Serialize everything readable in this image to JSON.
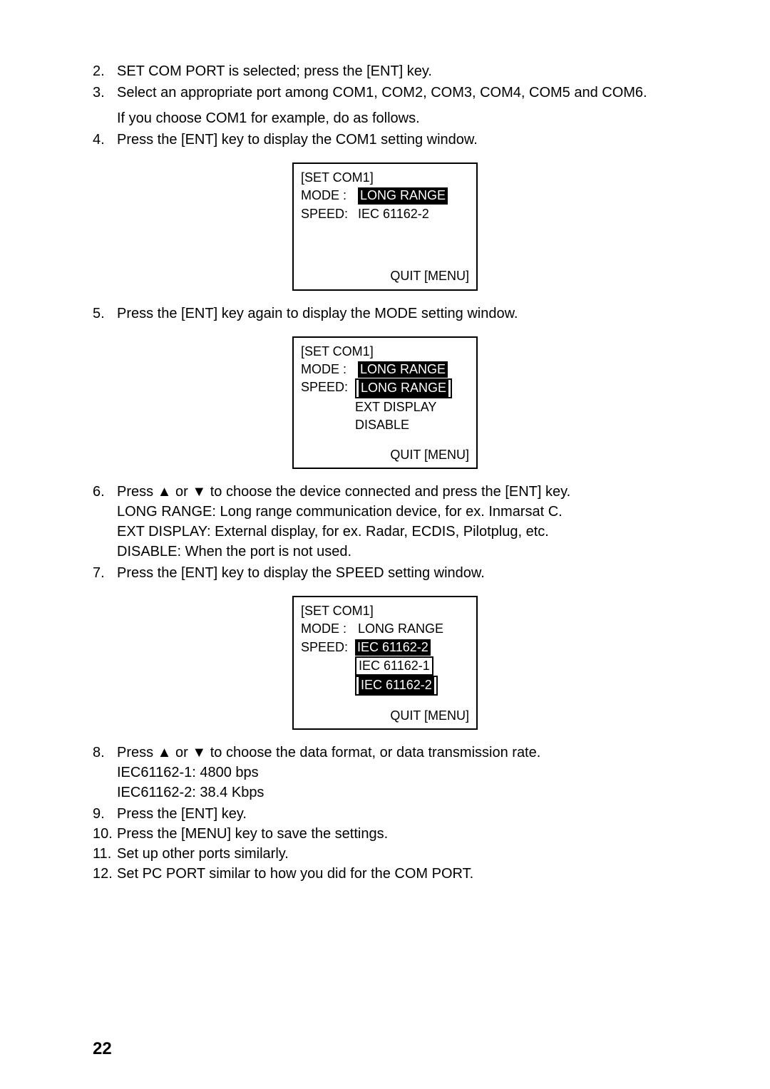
{
  "steps": {
    "s2": "SET COM PORT is selected; press the [ENT] key.",
    "s3": "Select an appropriate port among COM1, COM2, COM3, COM4, COM5 and COM6.",
    "s3b": "If you choose COM1 for example, do as follows.",
    "s4": "Press the [ENT] key to display the COM1 setting window.",
    "s5": "Press the [ENT] key again to display the MODE setting window.",
    "s6a": "Press ▲ or ▼ to choose the device connected and press the [ENT] key.",
    "s6b": "LONG RANGE: Long range communication device, for ex. Inmarsat C.",
    "s6c": "EXT DISPLAY: External display, for ex. Radar, ECDIS, Pilotplug, etc.",
    "s6d": "DISABLE: When the port is not used.",
    "s7": "Press the [ENT] key to display the SPEED setting window.",
    "s8a": "Press ▲ or ▼ to choose the data format, or data transmission rate.",
    "s8b": "IEC61162-1: 4800 bps",
    "s8c": "IEC61162-2: 38.4 Kbps",
    "s9": "Press the [ENT] key.",
    "s10": "Press the [MENU] key to save the settings.",
    "s11": "Set up other ports similarly.",
    "s12": "Set PC PORT similar to how you did for the COM PORT."
  },
  "numbers": {
    "n2": "2.",
    "n3": "3.",
    "n4": "4.",
    "n5": "5.",
    "n6": "6.",
    "n7": "7.",
    "n8": "8.",
    "n9": "9.",
    "n10": "10.",
    "n11": "11.",
    "n12": "12."
  },
  "lcd": {
    "title": "[SET COM1]",
    "mode_label": "MODE  :",
    "speed_label": "SPEED:",
    "long_range": "LONG RANGE",
    "iec2": "IEC 61162-2",
    "iec1": "IEC 61162-1",
    "ext_display": "EXT DISPLAY",
    "disable": "DISABLE",
    "quit": "QUIT [MENU]"
  },
  "page_number": "22"
}
